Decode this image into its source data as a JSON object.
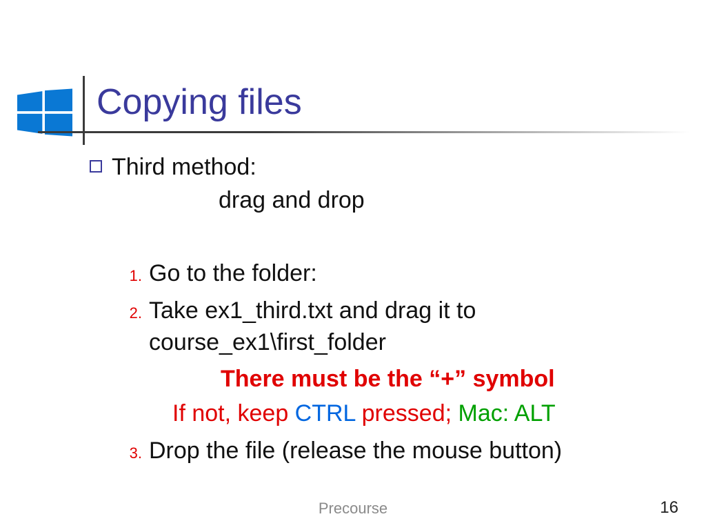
{
  "slide": {
    "title": "Copying files",
    "bullet": {
      "heading": "Third method:",
      "sub": "drag and drop"
    },
    "steps": {
      "n1": "1.",
      "t1": "Go to the folder:",
      "n2": "2.",
      "t2": "Take ex1_third.txt and drag it to course_ex1\\first_folder",
      "emph": "There must be the “+” symbol",
      "hint_pre": "If not, keep ",
      "hint_ctrl": "CTRL",
      "hint_mid": " pressed; ",
      "hint_mac": "Mac: ALT",
      "n3": "3.",
      "t3": "Drop the file (release the mouse button)"
    },
    "footer": "Precourse",
    "page": "16"
  }
}
